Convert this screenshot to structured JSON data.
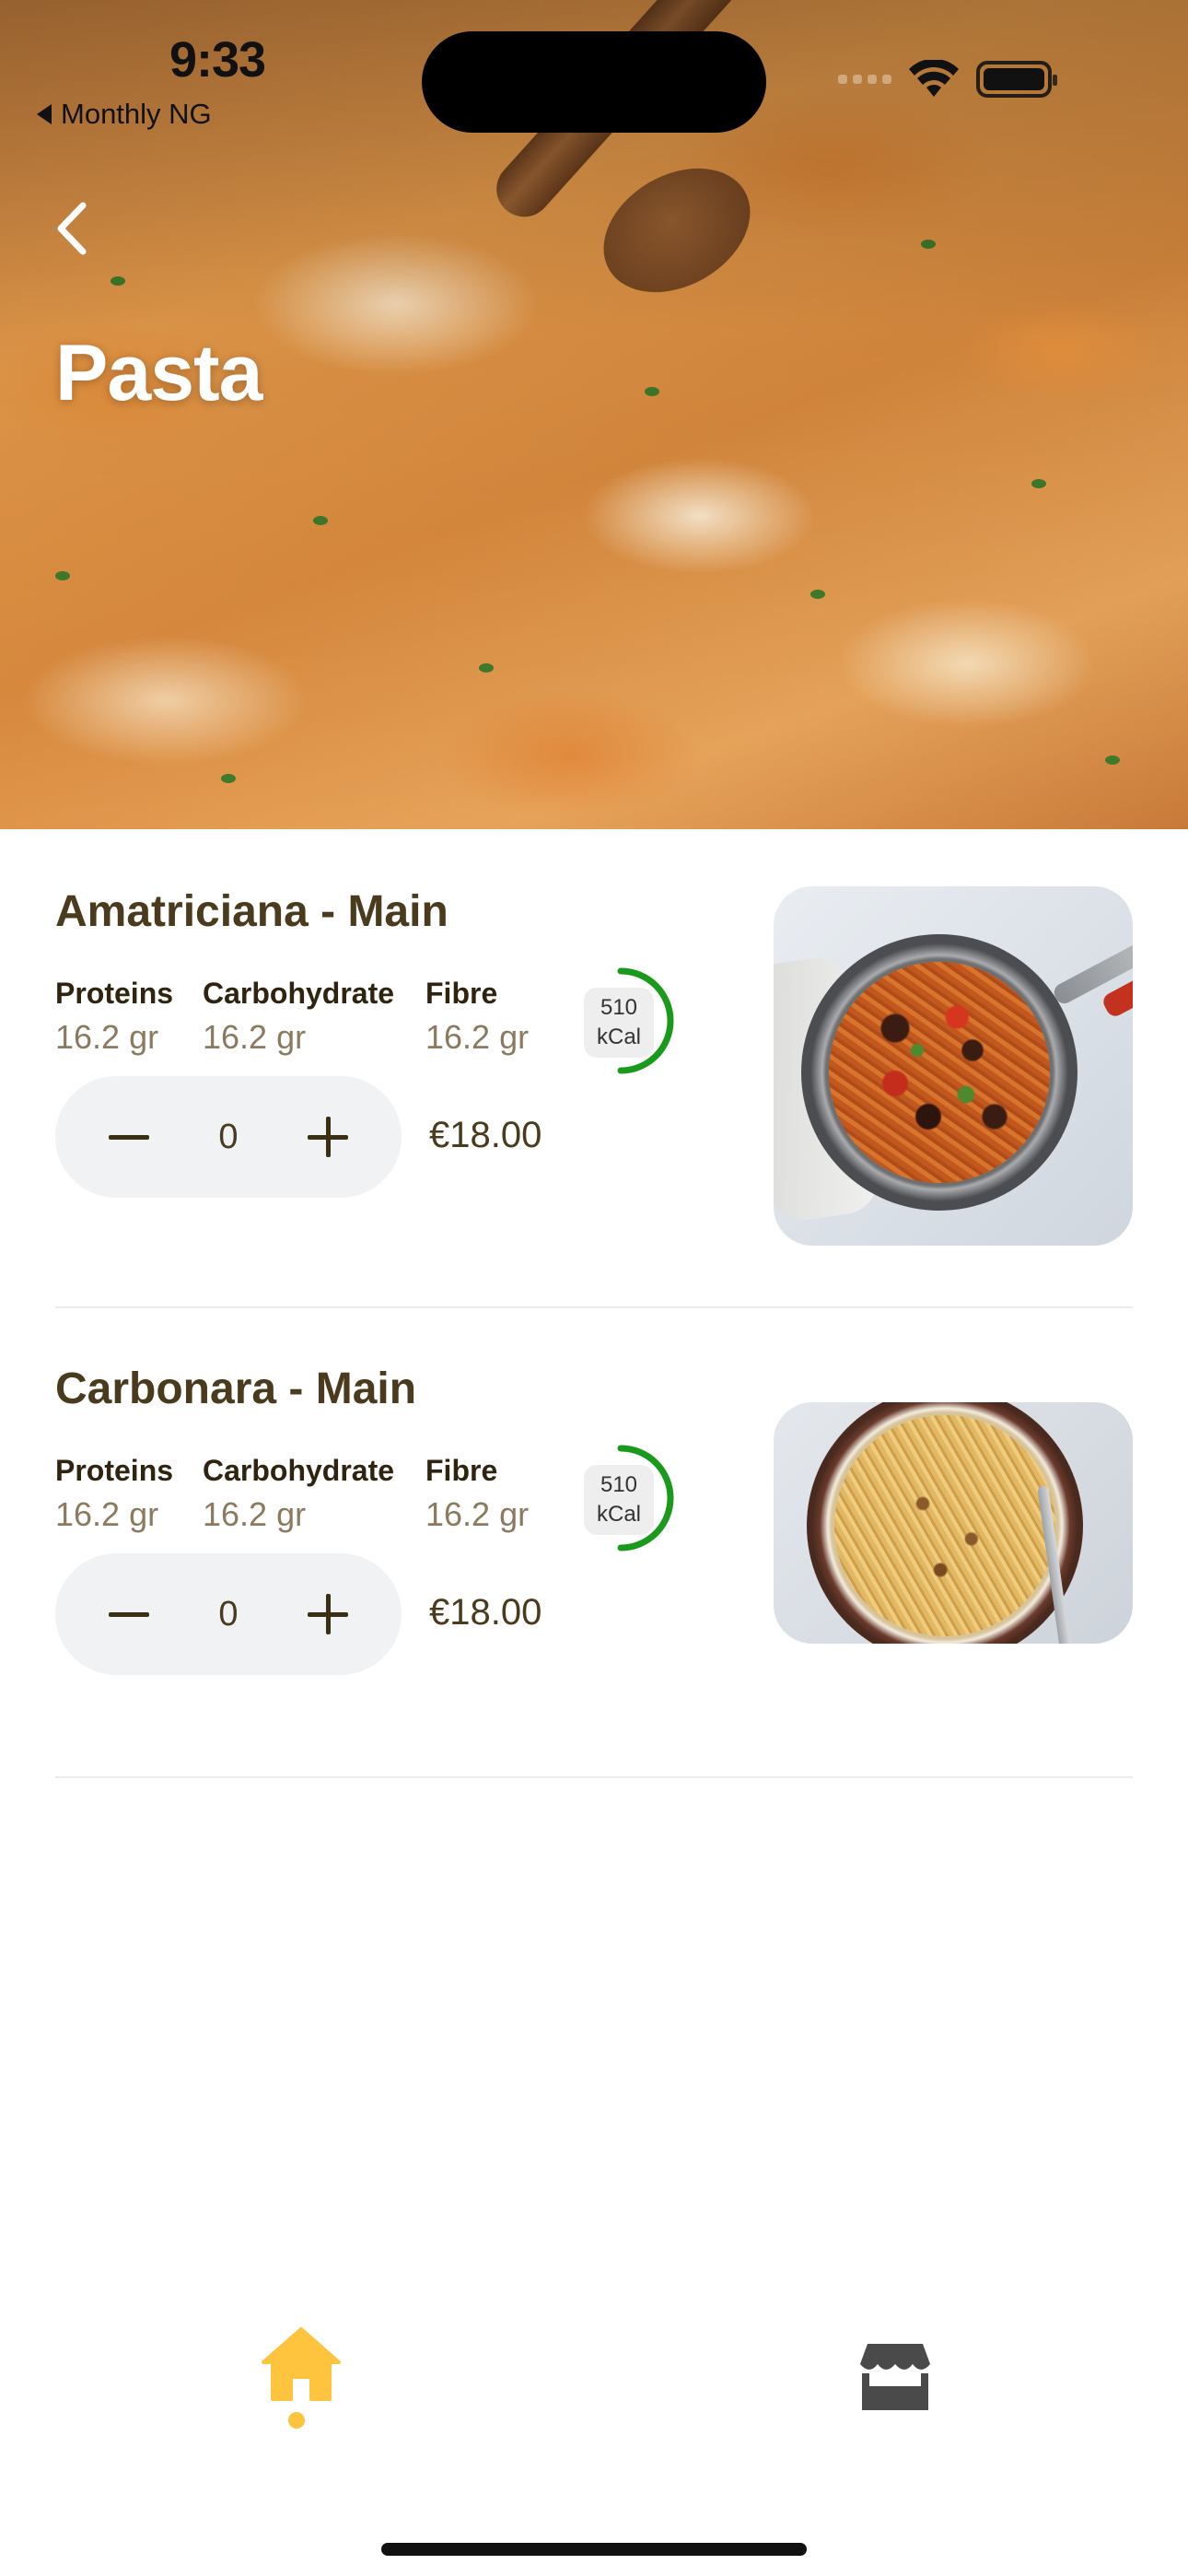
{
  "status_bar": {
    "time": "9:33",
    "back_app": "Monthly NG"
  },
  "header": {
    "title": "Pasta",
    "back_icon": "chevron-left-icon"
  },
  "products": [
    {
      "name": "Amatriciana - Main",
      "nutrients": [
        {
          "label": "Proteins",
          "value": "16.2 gr"
        },
        {
          "label": "Carbohydrate",
          "value": "16.2 gr"
        },
        {
          "label": "Fibre",
          "value": "16.2 gr"
        }
      ],
      "kcal": {
        "value": "510",
        "unit": "kCal"
      },
      "quantity": "0",
      "price": "€18.00"
    },
    {
      "name": "Carbonara - Main",
      "nutrients": [
        {
          "label": "Proteins",
          "value": "16.2 gr"
        },
        {
          "label": "Carbohydrate",
          "value": "16.2 gr"
        },
        {
          "label": "Fibre",
          "value": "16.2 gr"
        }
      ],
      "kcal": {
        "value": "510",
        "unit": "kCal"
      },
      "quantity": "0",
      "price": "€18.00"
    }
  ],
  "bottom_nav": {
    "items": [
      {
        "icon": "home-icon",
        "active": true
      },
      {
        "icon": "store-icon",
        "active": false
      }
    ]
  },
  "colors": {
    "accent": "#ffc43d",
    "kcal_ring": "#1a9a1a",
    "text_primary": "#4a3a1e",
    "text_secondary": "#8a7a60",
    "stepper_bg": "#f1f2f4"
  }
}
